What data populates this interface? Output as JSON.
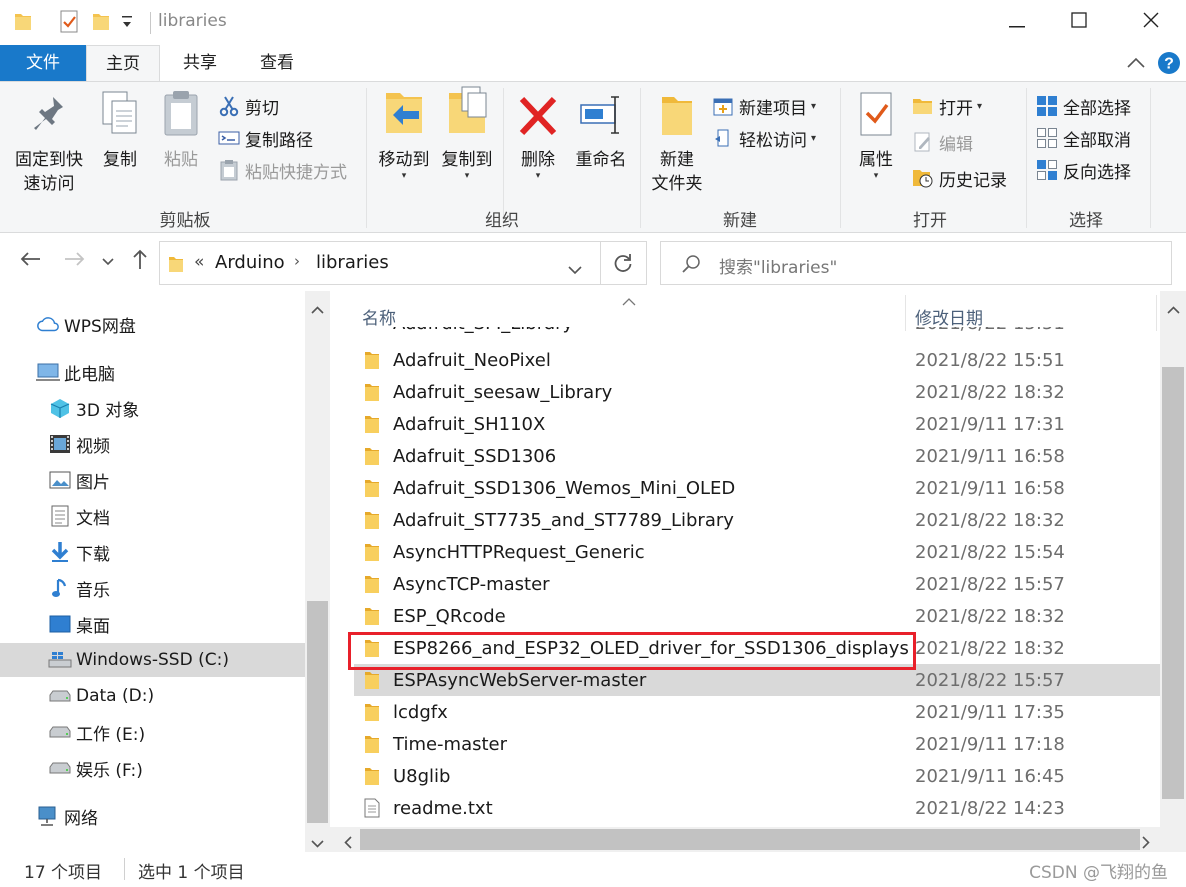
{
  "window": {
    "title": "libraries",
    "minimize_icon": "minimize-icon",
    "maximize_icon": "maximize-icon",
    "close_icon": "close-icon"
  },
  "tabs": [
    {
      "label": "文件"
    },
    {
      "label": "主页"
    },
    {
      "label": "共享"
    },
    {
      "label": "查看"
    }
  ],
  "ribbon": {
    "clipboard": {
      "group_label": "剪贴板",
      "pin": "固定到快\n速访问",
      "copy": "复制",
      "paste": "粘贴",
      "cut": "剪切",
      "copy_path": "复制路径",
      "paste_shortcut": "粘贴快捷方式"
    },
    "organize": {
      "group_label": "组织",
      "move_to": "移动到",
      "copy_to": "复制到",
      "delete": "删除",
      "rename": "重命名"
    },
    "new": {
      "group_label": "新建",
      "new_folder": "新建\n文件夹",
      "new_item": "新建项目",
      "easy_access": "轻松访问"
    },
    "open": {
      "group_label": "打开",
      "properties": "属性",
      "open": "打开",
      "edit": "编辑",
      "history": "历史记录"
    },
    "select": {
      "group_label": "选择",
      "select_all": "全部选择",
      "select_none": "全部取消",
      "invert": "反向选择"
    }
  },
  "address": {
    "breadcrumb": [
      "«",
      "Arduino",
      "libraries"
    ],
    "search_placeholder": "搜索\"libraries\""
  },
  "nav": [
    {
      "label": "WPS网盘",
      "icon": "cloud-icon"
    },
    {
      "label": "此电脑",
      "icon": "computer-icon"
    },
    {
      "label": "3D 对象",
      "icon": "cube-icon"
    },
    {
      "label": "视频",
      "icon": "video-icon"
    },
    {
      "label": "图片",
      "icon": "picture-icon"
    },
    {
      "label": "文档",
      "icon": "document-icon"
    },
    {
      "label": "下载",
      "icon": "download-icon"
    },
    {
      "label": "音乐",
      "icon": "music-icon"
    },
    {
      "label": "桌面",
      "icon": "desktop-icon"
    },
    {
      "label": "Windows-SSD (C:)",
      "icon": "drive-icon"
    },
    {
      "label": "Data (D:)",
      "icon": "drive-icon"
    },
    {
      "label": "工作 (E:)",
      "icon": "drive-icon"
    },
    {
      "label": "娱乐 (F:)",
      "icon": "drive-icon"
    },
    {
      "label": "网络",
      "icon": "network-icon"
    }
  ],
  "columns": {
    "name": "名称",
    "modified": "修改日期"
  },
  "files": [
    {
      "name": "Adafruit_NeoPixel",
      "date": "2021/8/22 15:51",
      "type": "folder"
    },
    {
      "name": "Adafruit_seesaw_Library",
      "date": "2021/8/22 18:32",
      "type": "folder"
    },
    {
      "name": "Adafruit_SH110X",
      "date": "2021/9/11 17:31",
      "type": "folder"
    },
    {
      "name": "Adafruit_SSD1306",
      "date": "2021/9/11 16:58",
      "type": "folder"
    },
    {
      "name": "Adafruit_SSD1306_Wemos_Mini_OLED",
      "date": "2021/9/11 16:58",
      "type": "folder"
    },
    {
      "name": "Adafruit_ST7735_and_ST7789_Library",
      "date": "2021/8/22 18:32",
      "type": "folder"
    },
    {
      "name": "AsyncHTTPRequest_Generic",
      "date": "2021/8/22 15:54",
      "type": "folder"
    },
    {
      "name": "AsyncTCP-master",
      "date": "2021/8/22 15:57",
      "type": "folder"
    },
    {
      "name": "ESP_QRcode",
      "date": "2021/8/22 18:32",
      "type": "folder"
    },
    {
      "name": "ESP8266_and_ESP32_OLED_driver_for_SSD1306_displays",
      "date": "2021/8/22 18:32",
      "type": "folder"
    },
    {
      "name": "ESPAsyncWebServer-master",
      "date": "2021/8/22 15:57",
      "type": "folder"
    },
    {
      "name": "lcdgfx",
      "date": "2021/9/11 17:35",
      "type": "folder"
    },
    {
      "name": "Time-master",
      "date": "2021/9/11 17:18",
      "type": "folder"
    },
    {
      "name": "U8glib",
      "date": "2021/9/11 16:45",
      "type": "folder"
    },
    {
      "name": "readme.txt",
      "date": "2021/8/22 14:23",
      "type": "file"
    }
  ],
  "status": {
    "item_count": "17 个项目",
    "selected": "选中 1 个项目",
    "watermark": "CSDN @飞翔的鱼"
  },
  "colors": {
    "file_tab": "#1979ca",
    "highlight": "#d9d9d9",
    "annotation": "#e8202a",
    "folder": "#f4c34f"
  }
}
